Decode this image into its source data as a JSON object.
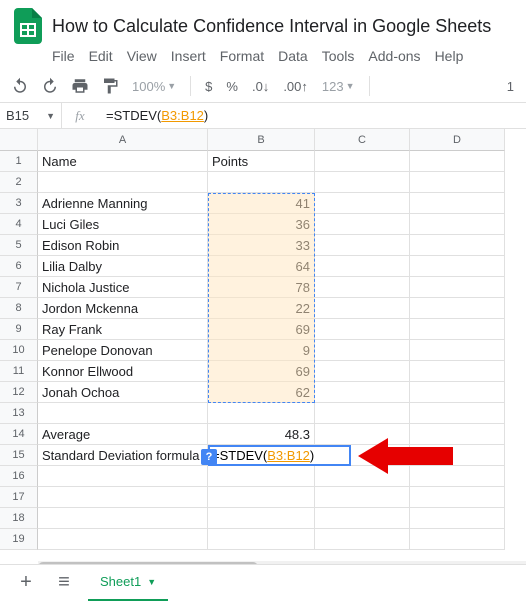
{
  "document": {
    "title": "How to Calculate Confidence Interval in Google Sheets"
  },
  "menu": [
    "File",
    "Edit",
    "View",
    "Insert",
    "Format",
    "Data",
    "Tools",
    "Add-ons",
    "Help"
  ],
  "toolbar": {
    "zoom": "100%",
    "num_fmt": "123",
    "right": "1"
  },
  "formula_bar": {
    "cell_ref": "B15",
    "prefix": "=STDEV(",
    "ref": "B3:B12",
    "suffix": ")"
  },
  "columns": [
    "A",
    "B",
    "C",
    "D"
  ],
  "rows_count": 19,
  "cells": {
    "A1": "Name",
    "B1": "Points",
    "A3": "Adrienne Manning",
    "B3": "41",
    "A4": "Luci Giles",
    "B4": "36",
    "A5": "Edison Robin",
    "B5": "33",
    "A6": "Lilia Dalby",
    "B6": "64",
    "A7": "Nichola Justice",
    "B7": "78",
    "A8": "Jordon Mckenna",
    "B8": "22",
    "A9": "Ray Frank",
    "B9": "69",
    "A10": "Penelope Donovan",
    "B10": "9",
    "A11": "Konnor Ellwood",
    "B11": "69",
    "A12": "Jonah Ochoa",
    "B12": "62",
    "A14": "Average",
    "B14": "48.3",
    "A15": "Standard Deviation formula"
  },
  "active_cell": {
    "prefix": "=STDEV(",
    "ref": "B3:B12",
    "suffix": ")",
    "hint": "?"
  },
  "tabs": {
    "sheet": "Sheet1"
  }
}
